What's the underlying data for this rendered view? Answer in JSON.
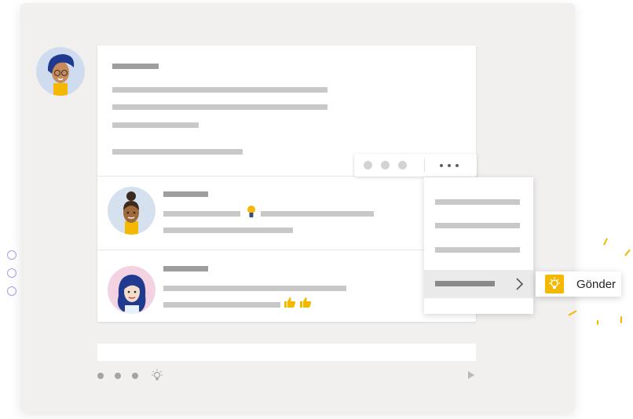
{
  "submenu": {
    "action_label": "Gönder",
    "action_icon": "lightbulb-icon"
  },
  "toolbar": {
    "more_icon": "more-options-icon"
  },
  "context_menu": {
    "selected_item_icon": "chevron-right-icon"
  },
  "compose": {
    "idea_icon": "lightbulb-icon",
    "send_icon": "send-icon"
  },
  "colors": {
    "background": "#f1f0ef",
    "accent": "#f5b800",
    "placeholder_text": "#c8c8c8",
    "selection": "#eaeaea"
  }
}
